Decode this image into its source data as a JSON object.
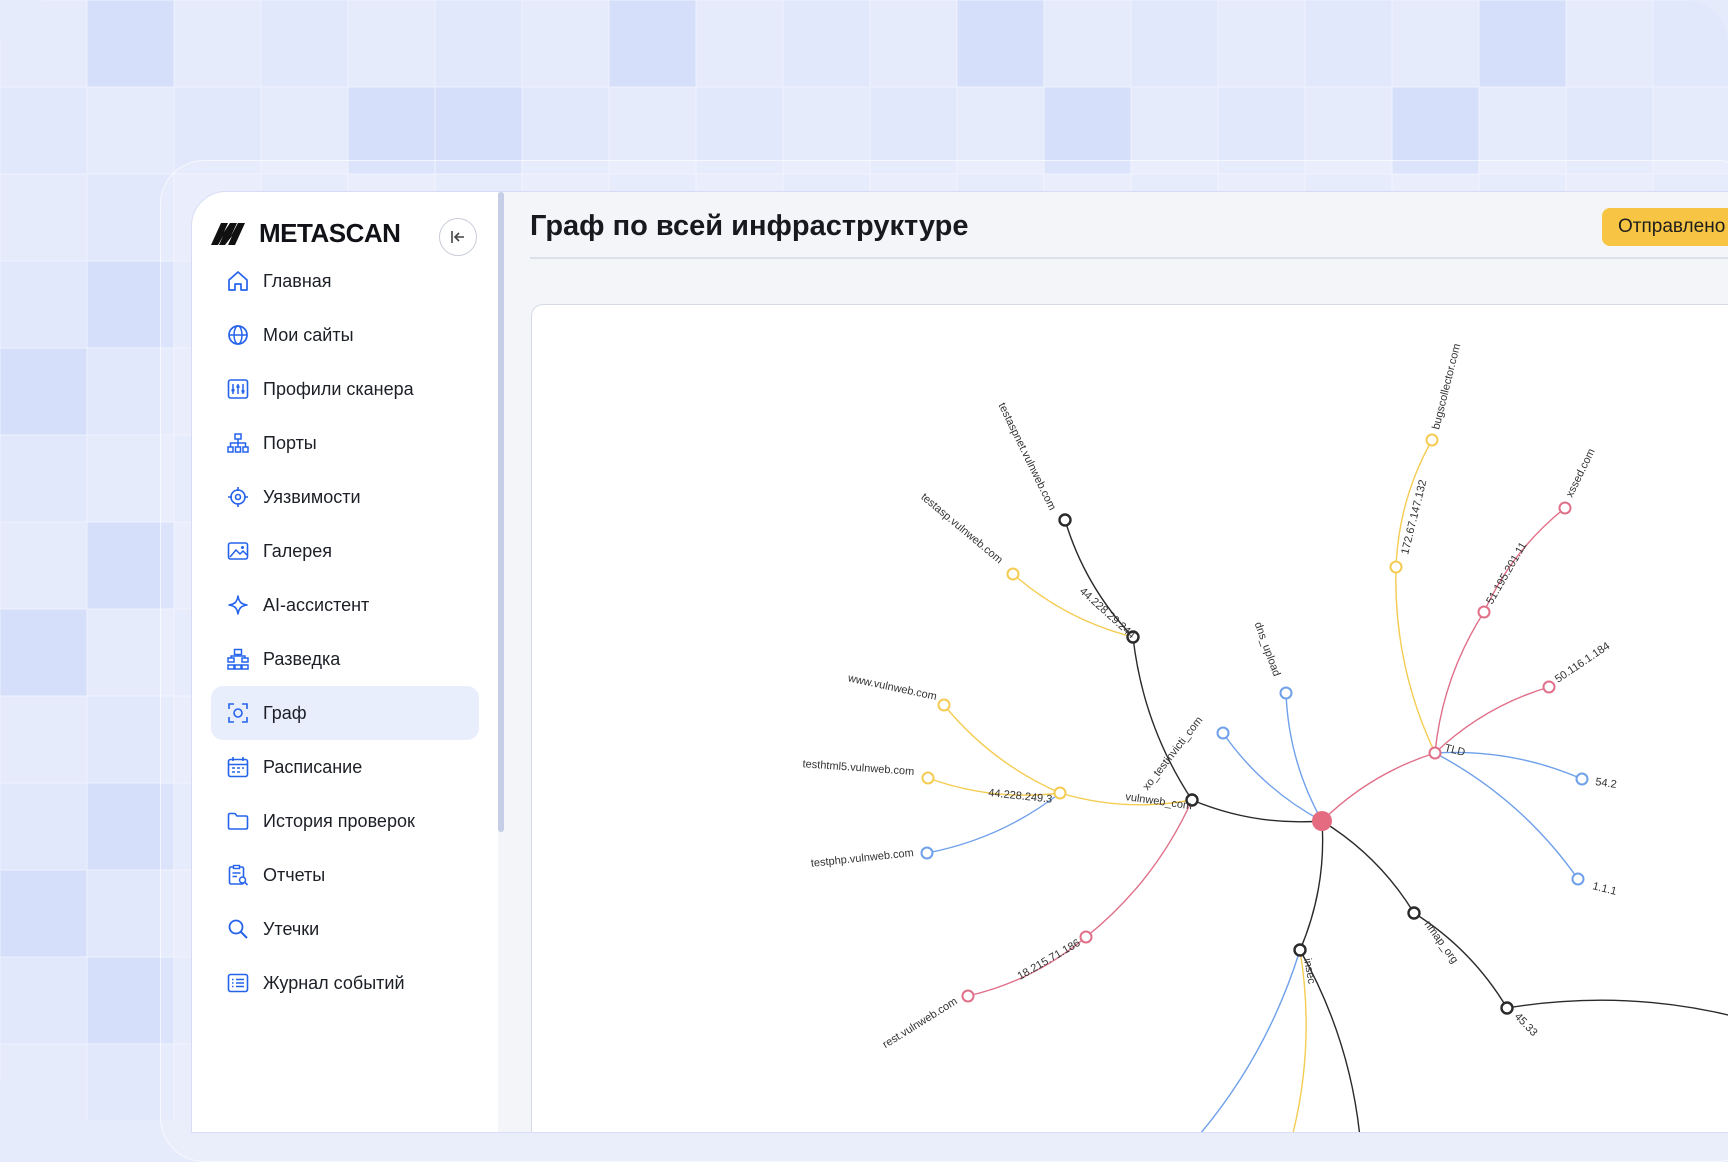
{
  "brand": {
    "name": "METASCAN"
  },
  "page": {
    "title": "Граф по всей инфраструктуре",
    "action_label": "Отправлено"
  },
  "sidebar": {
    "items": [
      {
        "label": "Главная",
        "icon": "home-icon"
      },
      {
        "label": "Мои сайты",
        "icon": "globe-icon"
      },
      {
        "label": "Профили сканера",
        "icon": "sliders-icon"
      },
      {
        "label": "Порты",
        "icon": "network-icon"
      },
      {
        "label": "Уязвимости",
        "icon": "target-icon"
      },
      {
        "label": "Галерея",
        "icon": "image-icon"
      },
      {
        "label": "AI-ассистент",
        "icon": "sparkle-icon"
      },
      {
        "label": "Разведка",
        "icon": "sitemap-icon"
      },
      {
        "label": "Граф",
        "icon": "graph-icon",
        "active": true
      },
      {
        "label": "Расписание",
        "icon": "calendar-icon"
      },
      {
        "label": "История проверок",
        "icon": "folder-icon"
      },
      {
        "label": "Отчеты",
        "icon": "report-icon"
      },
      {
        "label": "Утечки",
        "icon": "search-icon"
      },
      {
        "label": "Журнал событий",
        "icon": "list-icon"
      }
    ]
  },
  "graph": {
    "colors": {
      "black": "#2a2a2a",
      "yellow": "#f5cc52",
      "blue": "#6fa0ea",
      "red": "#e07089",
      "root": "#e46b80"
    },
    "nodes": {
      "testaspnet": "testaspnet.vulnweb.com",
      "testasp": "testasp.vulnweb.com",
      "ip_244": "44.228.29.244",
      "xo": "xo_testinvicti_com",
      "dns_upload": "dns_upload",
      "www": "www.vulnweb.com",
      "testhtml5": "testhtml5.vulnweb.com",
      "ip_249": "44.228.249.3",
      "vulnweb": "vulnweb_com",
      "testphp": "testphp.vulnweb.com",
      "ip_186": "18.215.71.186",
      "rest": "rest.vulnweb.com",
      "bugscollector": "bugscollector.com",
      "ip_132": "172.67.147.132",
      "xssed": "xssed.com",
      "ip_211": "51.195.201.11",
      "ip_184": "50.116.1.184",
      "tld": "TLD",
      "ip_54": "54.2",
      "ip_111": "1.1.1",
      "nmap": "nmap_org",
      "insecure": "insec",
      "ip_45": "45.33"
    }
  }
}
